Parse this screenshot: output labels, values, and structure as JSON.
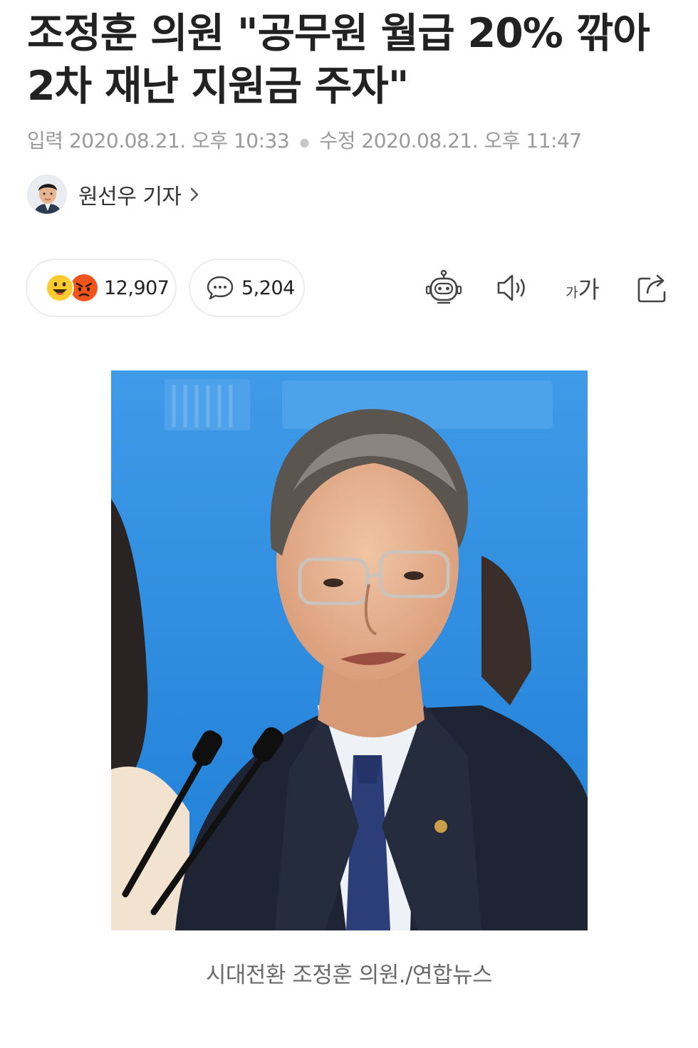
{
  "article": {
    "title": "조정훈 의원 \"공무원 월급 20% 깎아 2차 재난 지원금 주자\"",
    "published_label": "입력",
    "published": "2020.08.21. 오후 10:33",
    "modified_label": "수정",
    "modified": "2020.08.21. 오후 11:47",
    "author": "원선우 기자",
    "photo_caption": "시대전환 조정훈 의원./연합뉴스"
  },
  "actions": {
    "reactions_count": "12,907",
    "comments_count": "5,204",
    "font_size_label_small": "가",
    "font_size_label_large": "가"
  },
  "icons": {
    "reaction_like": "smile-emoji-icon",
    "reaction_angry": "angry-emoji-icon",
    "comment": "speech-bubble-icon",
    "summary": "robot-icon",
    "listen": "speaker-icon",
    "share": "share-icon",
    "author_link": "chevron-right-icon"
  },
  "colors": {
    "smile_yellow": "#ffcb2f",
    "angry_red": "#f2541c",
    "backdrop_blue": "#2f8fe0"
  }
}
